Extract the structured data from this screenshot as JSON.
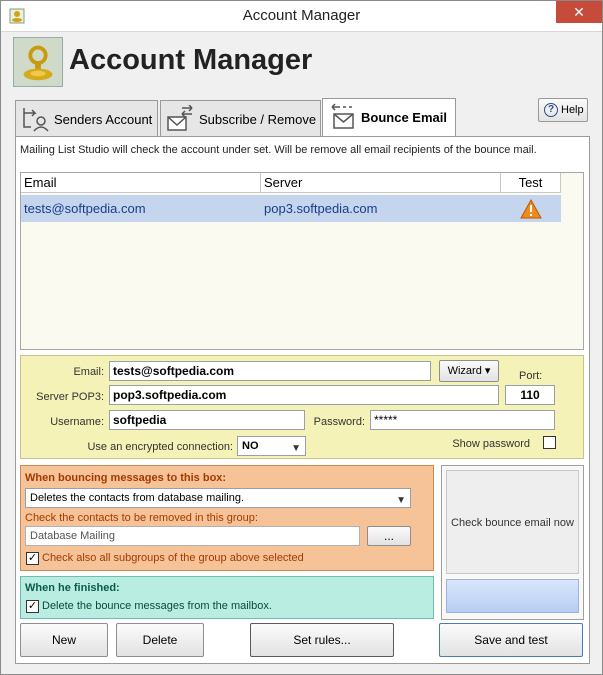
{
  "window": {
    "title": "Account Manager",
    "close_glyph": "✕"
  },
  "header": {
    "title": "Account Manager"
  },
  "tabs": [
    {
      "label": "Senders Account",
      "icon": "senders-account-icon"
    },
    {
      "label": "Subscribe / Remove",
      "icon": "subscribe-remove-icon"
    },
    {
      "label": "Bounce Email",
      "icon": "bounce-email-icon",
      "active": true
    }
  ],
  "help": {
    "label": "Help",
    "glyph": "?"
  },
  "info_text": "Mailing List Studio will check the account under set. Will be remove all email recipients of the bounce mail.",
  "table": {
    "columns": [
      "Email",
      "Server",
      "Test"
    ],
    "rows": [
      {
        "email": "tests@softpedia.com",
        "server": "pop3.softpedia.com",
        "test_icon": "warning-icon"
      }
    ]
  },
  "account": {
    "email_label": "Email:",
    "email_value": "tests@softpedia.com",
    "wizard_label": "Wizard",
    "port_label": "Port:",
    "port_value": "110",
    "server_label": "Server POP3:",
    "server_value": "pop3.softpedia.com",
    "username_label": "Username:",
    "username_value": "softpedia",
    "password_label": "Password:",
    "password_value": "*****",
    "encrypted_label": "Use an encrypted connection:",
    "encrypted_value": "NO",
    "show_password_label": "Show password"
  },
  "bouncing": {
    "title": "When bouncing messages to this box:",
    "action_value": "Deletes the contacts from database mailing.",
    "group_label": "Check the contacts to be removed in this group:",
    "group_value": "Database Mailing",
    "browse_label": "...",
    "subgroups_label": "Check also all subgroups of the group above selected"
  },
  "finished": {
    "title": "When he finished:",
    "delete_label": "Delete the bounce messages from the mailbox."
  },
  "check_button": "Check bounce email now",
  "buttons": {
    "new": "New",
    "delete": "Delete",
    "set_rules": "Set rules...",
    "save_test": "Save and test"
  },
  "colors": {
    "selection": "#c5d5ee",
    "yellow_panel": "#f4f2b6",
    "orange_panel": "#f6c298",
    "teal_panel": "#b9ede2",
    "close": "#c74b3a"
  }
}
